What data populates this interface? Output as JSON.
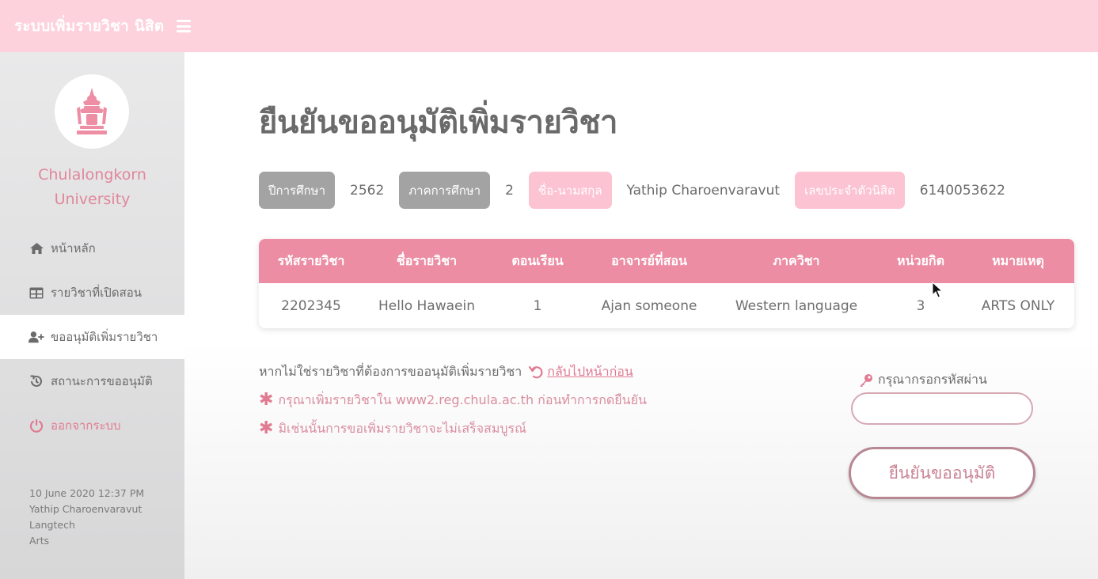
{
  "header": {
    "app_title": "ระบบเพิ่มรายวิชา นิสิต",
    "menu_icon": "hamburger-icon"
  },
  "sidebar": {
    "university_line1": "Chulalongkorn",
    "university_line2": "University",
    "items": [
      {
        "label": "หน้าหลัก",
        "icon": "home-icon"
      },
      {
        "label": "รายวิชาที่เปิดสอน",
        "icon": "table-icon"
      },
      {
        "label": "ขออนุมัติเพิ่มรายวิชา",
        "icon": "user-plus-icon"
      },
      {
        "label": "สถานะการขออนุมัติ",
        "icon": "history-icon"
      },
      {
        "label": "ออกจากระบบ",
        "icon": "power-icon"
      }
    ],
    "session": {
      "datetime": "10 June 2020 12:37 PM",
      "name": "Yathip Charoenvaravut",
      "program": "Langtech",
      "faculty": "Arts"
    }
  },
  "main": {
    "title": "ยืนยันขออนุมัติเพิ่มรายวิชา",
    "info": {
      "year_label": "ปีการศึกษา",
      "year_value": "2562",
      "semester_label": "ภาคการศึกษา",
      "semester_value": "2",
      "name_label": "ชื่อ-นามสกุล",
      "name_value": "Yathip Charoenvaravut",
      "student_id_label": "เลขประจำตัวนิสิต",
      "student_id_value": "6140053622"
    },
    "table": {
      "headers": [
        "รหัสรายวิชา",
        "ชื่อรายวิชา",
        "ตอนเรียน",
        "อาจารย์ที่สอน",
        "ภาควิชา",
        "หน่วยกิต",
        "หมายเหตุ"
      ],
      "rows": [
        [
          "2202345",
          "Hello Hawaein",
          "1",
          "Ajan someone",
          "Western language",
          "3",
          "ARTS ONLY"
        ]
      ]
    },
    "notes": {
      "not_this_course": "หากไม่ใช่รายวิชาที่ต้องการขออนุมัติเพิ่มรายวิชา",
      "back_link": "กลับไปหน้าก่อน",
      "warning1": "กรุณาเพิ่มรายวิชาใน www2.reg.chula.ac.th ก่อนทำการกดยืนยัน",
      "warning2": "มิเช่นนั้นการขอเพิ่มรายวิชาจะไม่เสร็จสมบูรณ์"
    },
    "password": {
      "label": "กรุณากรอกรหัสผ่าน",
      "value": "",
      "icon": "key-icon"
    },
    "confirm_button": "ยืนยันขออนุมัติ"
  },
  "colors": {
    "topbar": "#fdd2dc",
    "accent": "#ec8da3",
    "badge_grey": "#a3a3a3",
    "badge_pink": "#fcc3d2",
    "link": "#e07b92"
  }
}
